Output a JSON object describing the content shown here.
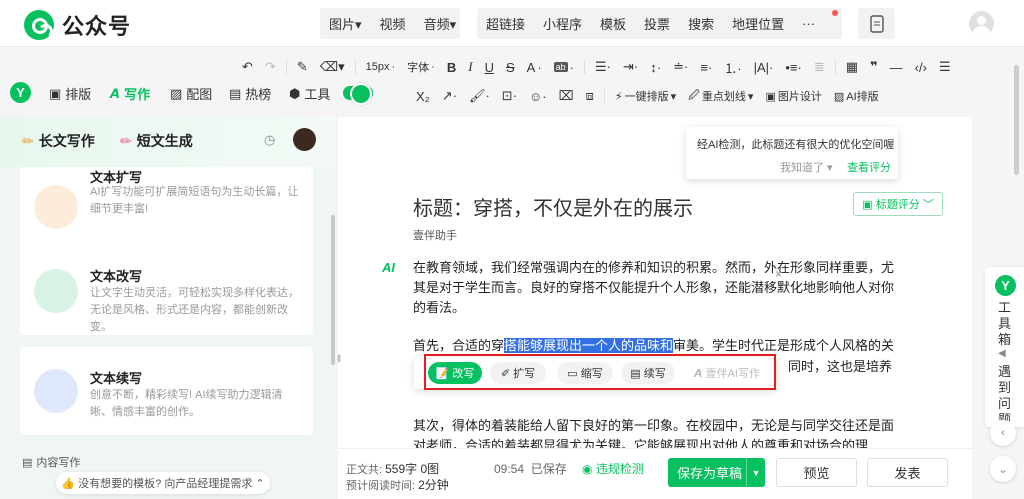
{
  "app": {
    "name": "公众号"
  },
  "top_groups": [
    {
      "items": [
        "图片",
        "视频",
        "音频"
      ]
    },
    {
      "items": [
        "超链接",
        "小程序",
        "模板",
        "投票",
        "搜索",
        "地理位置",
        "···"
      ]
    }
  ],
  "format_toolbar": {
    "font_size": "15px",
    "font_family": "字体",
    "buttons_row1": [
      "B",
      "I",
      "U",
      "S",
      "A",
      "ab"
    ],
    "buttons_row2": [
      "X₂",
      "一键排版",
      "重点划线",
      "图片设计",
      "AI排版"
    ]
  },
  "left_tabs": [
    {
      "label": "排版"
    },
    {
      "label": "写作"
    },
    {
      "label": "配图"
    },
    {
      "label": "热榜"
    },
    {
      "label": "工具"
    }
  ],
  "writing_panel": {
    "tabs": [
      "长文写作",
      "短文生成"
    ],
    "cards": [
      {
        "title": "文本扩写",
        "desc": "AI扩写功能可扩展简短语句为生动长篇，让细节更丰富!"
      },
      {
        "title": "文本改写",
        "desc": "让文字生动灵活，可轻松实现多样化表达，无论是风格、形式还是内容，都能创新改变。"
      },
      {
        "title": "文本续写",
        "desc": "创意不断，精彩续写! AI续写助力逻辑清晰、情感丰富的创作。"
      }
    ],
    "section_label": "内容写作",
    "feedback": "没有想要的模板? 向产品经理提需求"
  },
  "hint": {
    "text": "经AI检测，此标题还有很大的优化空间喔",
    "dismiss": "我知道了",
    "action": "查看评分"
  },
  "article": {
    "title": "标题：穿搭，不仅是外在的展示",
    "author": "壹伴助手",
    "score_button": "标题评分",
    "ai_marker": "AI",
    "p1": "在教育领域，我们经常强调内在的修养和知识的积累。然而，外在形象同样重要，尤其是对于学生而言。良好的穿搭不仅能提升个人形象，还能潜移默化地影响他人对你的看法。",
    "p2_before": "首先，合适的穿",
    "p2_selected": "搭能够展现出一个人的品味和",
    "p2_after": "审美。学生时代正是形成个人风格的关",
    "p2_line2_tail": "同时，这也是培养",
    "p3_line1": "其次，得体的着装能给人留下良好的第一印象。在校园中，无论是与同学交往还是面",
    "p3_line2": "对老师，合适的着装都显得尤为关键。它能够展现出对他人的尊重和对场合的理"
  },
  "ai_popup": {
    "buttons": [
      "改写",
      "扩写",
      "缩写",
      "续写"
    ],
    "disabled": "壹伴AI写作"
  },
  "bottom": {
    "word_count_label": "正文共:",
    "word_count": "559字 0图",
    "read_time_label": "预计阅读时间:",
    "read_time": "2分钟",
    "saved_time": "09:54",
    "saved_label": "已保存",
    "violation": "违规检测",
    "save_draft": "保存为草稿",
    "preview": "预览",
    "publish": "发表"
  },
  "right_side": {
    "toolbox": "工具箱",
    "feedback": "遇到问题"
  },
  "colors": {
    "brand": "#07c160",
    "selection": "#3470e4",
    "highlight_box": "#e02020"
  }
}
